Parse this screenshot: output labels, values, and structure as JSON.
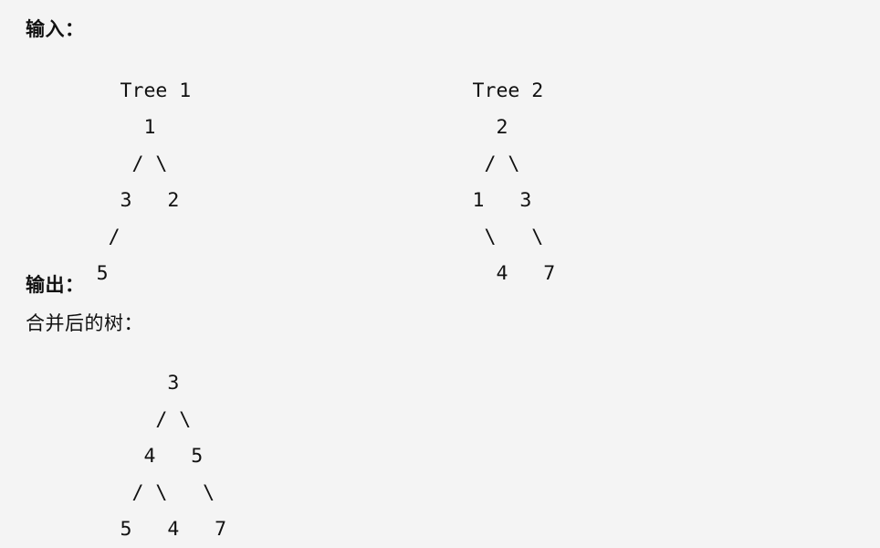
{
  "labels": {
    "input": "输入：",
    "output": "输出：",
    "merged": "合并后的树："
  },
  "colors": {
    "background": "#f4f4f4",
    "text": "#111111"
  },
  "trees": {
    "tree1": {
      "title": "Tree 1",
      "art_lines": [
        "        Tree 1",
        "          1",
        "         / \\",
        "        3   2",
        "       /",
        "      5"
      ],
      "root": 1,
      "nodes": [
        {
          "value": 1,
          "depth": 0,
          "path": ""
        },
        {
          "value": 3,
          "depth": 1,
          "path": "L"
        },
        {
          "value": 2,
          "depth": 1,
          "path": "R"
        },
        {
          "value": 5,
          "depth": 2,
          "path": "LL"
        }
      ]
    },
    "tree2": {
      "title": "Tree 2",
      "art_lines": [
        "        Tree 2",
        "          2",
        "         / \\",
        "        1   3",
        "         \\   \\",
        "          4   7"
      ],
      "root": 2,
      "nodes": [
        {
          "value": 2,
          "depth": 0,
          "path": ""
        },
        {
          "value": 1,
          "depth": 1,
          "path": "L"
        },
        {
          "value": 3,
          "depth": 1,
          "path": "R"
        },
        {
          "value": 4,
          "depth": 2,
          "path": "LR"
        },
        {
          "value": 7,
          "depth": 2,
          "path": "RR"
        }
      ]
    },
    "merged": {
      "title": "合并后的树：",
      "art_lines": [
        "            3",
        "           / \\",
        "          4   5",
        "         / \\   \\",
        "        5   4   7"
      ],
      "root": 3,
      "nodes": [
        {
          "value": 3,
          "depth": 0,
          "path": ""
        },
        {
          "value": 4,
          "depth": 1,
          "path": "L"
        },
        {
          "value": 5,
          "depth": 1,
          "path": "R"
        },
        {
          "value": 5,
          "depth": 2,
          "path": "LL"
        },
        {
          "value": 4,
          "depth": 2,
          "path": "LR"
        },
        {
          "value": 7,
          "depth": 2,
          "path": "RR"
        }
      ]
    }
  }
}
